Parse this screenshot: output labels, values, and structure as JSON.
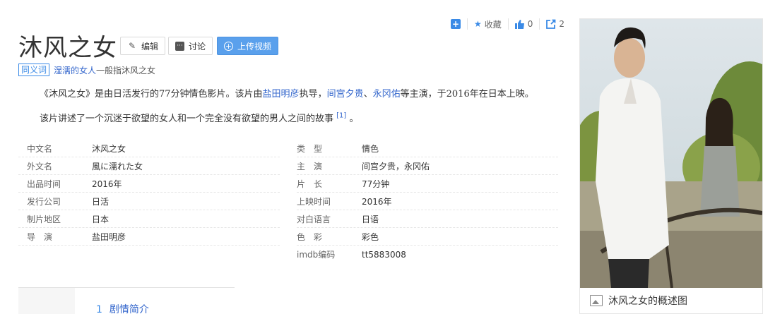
{
  "topbar": {
    "collect_label": "收藏",
    "like_count": "0",
    "share_count": "2"
  },
  "title": "沐风之女",
  "buttons": {
    "edit": "编辑",
    "discuss": "讨论",
    "upload": "上传视频"
  },
  "synonym": {
    "tag": "同义词",
    "link": "湿濡的女人",
    "suffix": "一般指沐风之女"
  },
  "para1": {
    "t1": "《沐风之女》是由日活发行的77分钟情色影片。该片由",
    "director": "盐田明彦",
    "t2": "执导，",
    "actor1": "间宫夕贵",
    "t3": "、",
    "actor2": "永冈佑",
    "t4": "等主演，于2016年在日本上映。"
  },
  "para2": {
    "text": "该片讲述了一个沉迷于欲望的女人和一个完全没有欲望的男人之间的故事",
    "ref": "[1]",
    "end": "。"
  },
  "info_left": [
    {
      "k": "中文名",
      "v": "沐风之女"
    },
    {
      "k": "外文名",
      "v": "風に濡れた女"
    },
    {
      "k": "出品时间",
      "v": "2016年"
    },
    {
      "k": "发行公司",
      "v": "日活"
    },
    {
      "k": "制片地区",
      "v": "日本"
    },
    {
      "k": "导　演",
      "v": "盐田明彦"
    }
  ],
  "info_right": [
    {
      "k": "类　型",
      "v": "情色"
    },
    {
      "k": "主　演",
      "v": "间宫夕贵，永冈佑"
    },
    {
      "k": "片　长",
      "v": "77分钟"
    },
    {
      "k": "上映时间",
      "v": "2016年"
    },
    {
      "k": "对白语言",
      "v": "日语"
    },
    {
      "k": "色　彩",
      "v": "彩色"
    },
    {
      "k": "imdb编码",
      "v": "tt5883008"
    }
  ],
  "toc": {
    "num": "1",
    "label": "剧情简介"
  },
  "poster": {
    "caption": "沐风之女的概述图"
  }
}
